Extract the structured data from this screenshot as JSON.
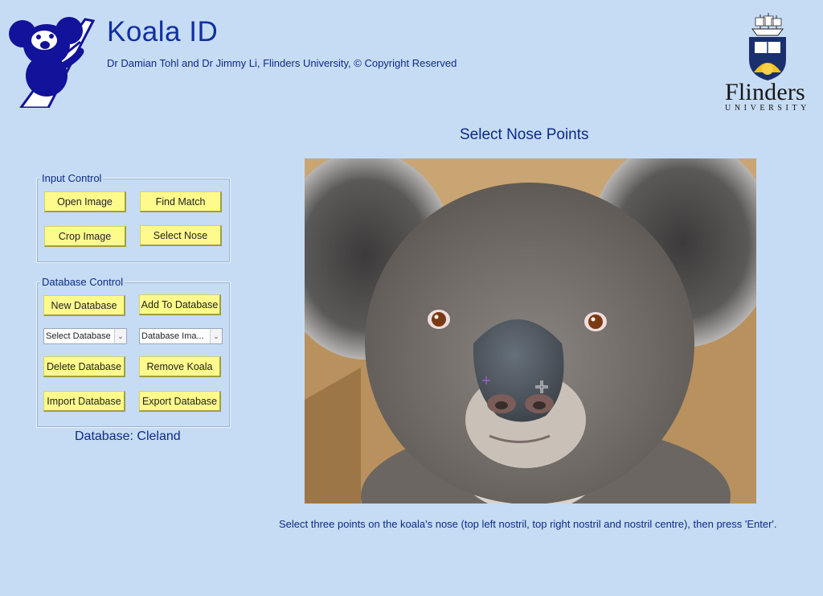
{
  "header": {
    "title": "Koala ID",
    "subtitle": "Dr Damian Tohl and Dr Jimmy Li, Flinders University, © Copyright Reserved",
    "university_name": "Flinders",
    "university_sub": "UNIVERSITY"
  },
  "input_control": {
    "label": "Input Control",
    "buttons": {
      "open_image": "Open Image",
      "find_match": "Find Match",
      "crop_image": "Crop Image",
      "select_nose": "Select Nose"
    }
  },
  "database_control": {
    "label": "Database Control",
    "buttons": {
      "new_database": "New Database",
      "add_to_database": "Add To Database",
      "delete_database": "Delete Database",
      "remove_koala": "Remove Koala",
      "import_database": "Import Database",
      "export_database": "Export Database"
    },
    "selects": {
      "database": "Select Database",
      "database_image": "Database Ima..."
    }
  },
  "status": {
    "database": "Database: Cleland"
  },
  "image_panel": {
    "title": "Select Nose Points",
    "instructions": "Select three points on the koala's nose (top left nostril, top right nostril and nostril centre), then press 'Enter'."
  },
  "colors": {
    "background": "#c6dcf4",
    "button": "#fefb8c",
    "text": "#0d2a86",
    "logo": "#12129a"
  },
  "icons": {
    "app_logo": "koala-logo-icon",
    "university_crest": "crest-icon",
    "crosshair": "crosshair-icon",
    "dropdown": "chevron-down-icon"
  }
}
